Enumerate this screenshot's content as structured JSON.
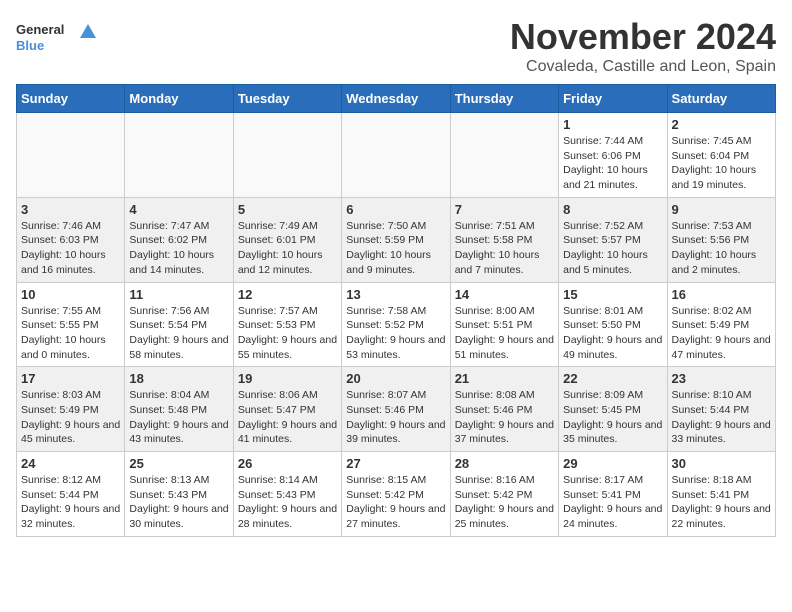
{
  "logo": {
    "line1": "General",
    "line2": "Blue"
  },
  "title": "November 2024",
  "location": "Covaleda, Castille and Leon, Spain",
  "days_of_week": [
    "Sunday",
    "Monday",
    "Tuesday",
    "Wednesday",
    "Thursday",
    "Friday",
    "Saturday"
  ],
  "weeks": [
    [
      {
        "day": "",
        "info": ""
      },
      {
        "day": "",
        "info": ""
      },
      {
        "day": "",
        "info": ""
      },
      {
        "day": "",
        "info": ""
      },
      {
        "day": "",
        "info": ""
      },
      {
        "day": "1",
        "info": "Sunrise: 7:44 AM\nSunset: 6:06 PM\nDaylight: 10 hours and 21 minutes."
      },
      {
        "day": "2",
        "info": "Sunrise: 7:45 AM\nSunset: 6:04 PM\nDaylight: 10 hours and 19 minutes."
      }
    ],
    [
      {
        "day": "3",
        "info": "Sunrise: 7:46 AM\nSunset: 6:03 PM\nDaylight: 10 hours and 16 minutes."
      },
      {
        "day": "4",
        "info": "Sunrise: 7:47 AM\nSunset: 6:02 PM\nDaylight: 10 hours and 14 minutes."
      },
      {
        "day": "5",
        "info": "Sunrise: 7:49 AM\nSunset: 6:01 PM\nDaylight: 10 hours and 12 minutes."
      },
      {
        "day": "6",
        "info": "Sunrise: 7:50 AM\nSunset: 5:59 PM\nDaylight: 10 hours and 9 minutes."
      },
      {
        "day": "7",
        "info": "Sunrise: 7:51 AM\nSunset: 5:58 PM\nDaylight: 10 hours and 7 minutes."
      },
      {
        "day": "8",
        "info": "Sunrise: 7:52 AM\nSunset: 5:57 PM\nDaylight: 10 hours and 5 minutes."
      },
      {
        "day": "9",
        "info": "Sunrise: 7:53 AM\nSunset: 5:56 PM\nDaylight: 10 hours and 2 minutes."
      }
    ],
    [
      {
        "day": "10",
        "info": "Sunrise: 7:55 AM\nSunset: 5:55 PM\nDaylight: 10 hours and 0 minutes."
      },
      {
        "day": "11",
        "info": "Sunrise: 7:56 AM\nSunset: 5:54 PM\nDaylight: 9 hours and 58 minutes."
      },
      {
        "day": "12",
        "info": "Sunrise: 7:57 AM\nSunset: 5:53 PM\nDaylight: 9 hours and 55 minutes."
      },
      {
        "day": "13",
        "info": "Sunrise: 7:58 AM\nSunset: 5:52 PM\nDaylight: 9 hours and 53 minutes."
      },
      {
        "day": "14",
        "info": "Sunrise: 8:00 AM\nSunset: 5:51 PM\nDaylight: 9 hours and 51 minutes."
      },
      {
        "day": "15",
        "info": "Sunrise: 8:01 AM\nSunset: 5:50 PM\nDaylight: 9 hours and 49 minutes."
      },
      {
        "day": "16",
        "info": "Sunrise: 8:02 AM\nSunset: 5:49 PM\nDaylight: 9 hours and 47 minutes."
      }
    ],
    [
      {
        "day": "17",
        "info": "Sunrise: 8:03 AM\nSunset: 5:49 PM\nDaylight: 9 hours and 45 minutes."
      },
      {
        "day": "18",
        "info": "Sunrise: 8:04 AM\nSunset: 5:48 PM\nDaylight: 9 hours and 43 minutes."
      },
      {
        "day": "19",
        "info": "Sunrise: 8:06 AM\nSunset: 5:47 PM\nDaylight: 9 hours and 41 minutes."
      },
      {
        "day": "20",
        "info": "Sunrise: 8:07 AM\nSunset: 5:46 PM\nDaylight: 9 hours and 39 minutes."
      },
      {
        "day": "21",
        "info": "Sunrise: 8:08 AM\nSunset: 5:46 PM\nDaylight: 9 hours and 37 minutes."
      },
      {
        "day": "22",
        "info": "Sunrise: 8:09 AM\nSunset: 5:45 PM\nDaylight: 9 hours and 35 minutes."
      },
      {
        "day": "23",
        "info": "Sunrise: 8:10 AM\nSunset: 5:44 PM\nDaylight: 9 hours and 33 minutes."
      }
    ],
    [
      {
        "day": "24",
        "info": "Sunrise: 8:12 AM\nSunset: 5:44 PM\nDaylight: 9 hours and 32 minutes."
      },
      {
        "day": "25",
        "info": "Sunrise: 8:13 AM\nSunset: 5:43 PM\nDaylight: 9 hours and 30 minutes."
      },
      {
        "day": "26",
        "info": "Sunrise: 8:14 AM\nSunset: 5:43 PM\nDaylight: 9 hours and 28 minutes."
      },
      {
        "day": "27",
        "info": "Sunrise: 8:15 AM\nSunset: 5:42 PM\nDaylight: 9 hours and 27 minutes."
      },
      {
        "day": "28",
        "info": "Sunrise: 8:16 AM\nSunset: 5:42 PM\nDaylight: 9 hours and 25 minutes."
      },
      {
        "day": "29",
        "info": "Sunrise: 8:17 AM\nSunset: 5:41 PM\nDaylight: 9 hours and 24 minutes."
      },
      {
        "day": "30",
        "info": "Sunrise: 8:18 AM\nSunset: 5:41 PM\nDaylight: 9 hours and 22 minutes."
      }
    ]
  ]
}
